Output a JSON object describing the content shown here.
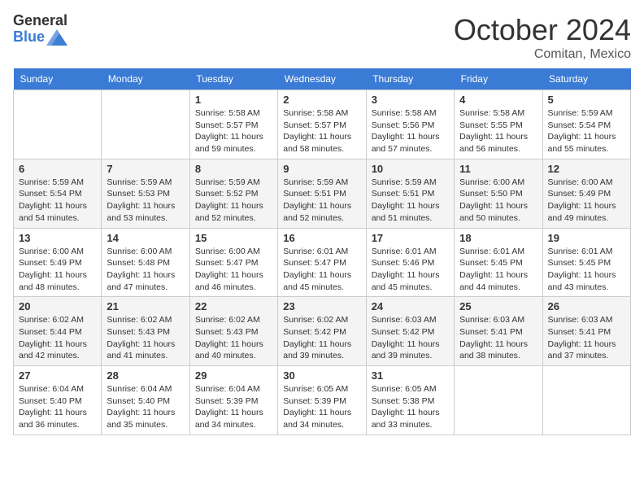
{
  "header": {
    "logo_general": "General",
    "logo_blue": "Blue",
    "month_title": "October 2024",
    "location": "Comitan, Mexico"
  },
  "days_of_week": [
    "Sunday",
    "Monday",
    "Tuesday",
    "Wednesday",
    "Thursday",
    "Friday",
    "Saturday"
  ],
  "weeks": [
    [
      {
        "day": "",
        "info": ""
      },
      {
        "day": "",
        "info": ""
      },
      {
        "day": "1",
        "info": "Sunrise: 5:58 AM\nSunset: 5:57 PM\nDaylight: 11 hours and 59 minutes."
      },
      {
        "day": "2",
        "info": "Sunrise: 5:58 AM\nSunset: 5:57 PM\nDaylight: 11 hours and 58 minutes."
      },
      {
        "day": "3",
        "info": "Sunrise: 5:58 AM\nSunset: 5:56 PM\nDaylight: 11 hours and 57 minutes."
      },
      {
        "day": "4",
        "info": "Sunrise: 5:58 AM\nSunset: 5:55 PM\nDaylight: 11 hours and 56 minutes."
      },
      {
        "day": "5",
        "info": "Sunrise: 5:59 AM\nSunset: 5:54 PM\nDaylight: 11 hours and 55 minutes."
      }
    ],
    [
      {
        "day": "6",
        "info": "Sunrise: 5:59 AM\nSunset: 5:54 PM\nDaylight: 11 hours and 54 minutes."
      },
      {
        "day": "7",
        "info": "Sunrise: 5:59 AM\nSunset: 5:53 PM\nDaylight: 11 hours and 53 minutes."
      },
      {
        "day": "8",
        "info": "Sunrise: 5:59 AM\nSunset: 5:52 PM\nDaylight: 11 hours and 52 minutes."
      },
      {
        "day": "9",
        "info": "Sunrise: 5:59 AM\nSunset: 5:51 PM\nDaylight: 11 hours and 52 minutes."
      },
      {
        "day": "10",
        "info": "Sunrise: 5:59 AM\nSunset: 5:51 PM\nDaylight: 11 hours and 51 minutes."
      },
      {
        "day": "11",
        "info": "Sunrise: 6:00 AM\nSunset: 5:50 PM\nDaylight: 11 hours and 50 minutes."
      },
      {
        "day": "12",
        "info": "Sunrise: 6:00 AM\nSunset: 5:49 PM\nDaylight: 11 hours and 49 minutes."
      }
    ],
    [
      {
        "day": "13",
        "info": "Sunrise: 6:00 AM\nSunset: 5:49 PM\nDaylight: 11 hours and 48 minutes."
      },
      {
        "day": "14",
        "info": "Sunrise: 6:00 AM\nSunset: 5:48 PM\nDaylight: 11 hours and 47 minutes."
      },
      {
        "day": "15",
        "info": "Sunrise: 6:00 AM\nSunset: 5:47 PM\nDaylight: 11 hours and 46 minutes."
      },
      {
        "day": "16",
        "info": "Sunrise: 6:01 AM\nSunset: 5:47 PM\nDaylight: 11 hours and 45 minutes."
      },
      {
        "day": "17",
        "info": "Sunrise: 6:01 AM\nSunset: 5:46 PM\nDaylight: 11 hours and 45 minutes."
      },
      {
        "day": "18",
        "info": "Sunrise: 6:01 AM\nSunset: 5:45 PM\nDaylight: 11 hours and 44 minutes."
      },
      {
        "day": "19",
        "info": "Sunrise: 6:01 AM\nSunset: 5:45 PM\nDaylight: 11 hours and 43 minutes."
      }
    ],
    [
      {
        "day": "20",
        "info": "Sunrise: 6:02 AM\nSunset: 5:44 PM\nDaylight: 11 hours and 42 minutes."
      },
      {
        "day": "21",
        "info": "Sunrise: 6:02 AM\nSunset: 5:43 PM\nDaylight: 11 hours and 41 minutes."
      },
      {
        "day": "22",
        "info": "Sunrise: 6:02 AM\nSunset: 5:43 PM\nDaylight: 11 hours and 40 minutes."
      },
      {
        "day": "23",
        "info": "Sunrise: 6:02 AM\nSunset: 5:42 PM\nDaylight: 11 hours and 39 minutes."
      },
      {
        "day": "24",
        "info": "Sunrise: 6:03 AM\nSunset: 5:42 PM\nDaylight: 11 hours and 39 minutes."
      },
      {
        "day": "25",
        "info": "Sunrise: 6:03 AM\nSunset: 5:41 PM\nDaylight: 11 hours and 38 minutes."
      },
      {
        "day": "26",
        "info": "Sunrise: 6:03 AM\nSunset: 5:41 PM\nDaylight: 11 hours and 37 minutes."
      }
    ],
    [
      {
        "day": "27",
        "info": "Sunrise: 6:04 AM\nSunset: 5:40 PM\nDaylight: 11 hours and 36 minutes."
      },
      {
        "day": "28",
        "info": "Sunrise: 6:04 AM\nSunset: 5:40 PM\nDaylight: 11 hours and 35 minutes."
      },
      {
        "day": "29",
        "info": "Sunrise: 6:04 AM\nSunset: 5:39 PM\nDaylight: 11 hours and 34 minutes."
      },
      {
        "day": "30",
        "info": "Sunrise: 6:05 AM\nSunset: 5:39 PM\nDaylight: 11 hours and 34 minutes."
      },
      {
        "day": "31",
        "info": "Sunrise: 6:05 AM\nSunset: 5:38 PM\nDaylight: 11 hours and 33 minutes."
      },
      {
        "day": "",
        "info": ""
      },
      {
        "day": "",
        "info": ""
      }
    ]
  ]
}
